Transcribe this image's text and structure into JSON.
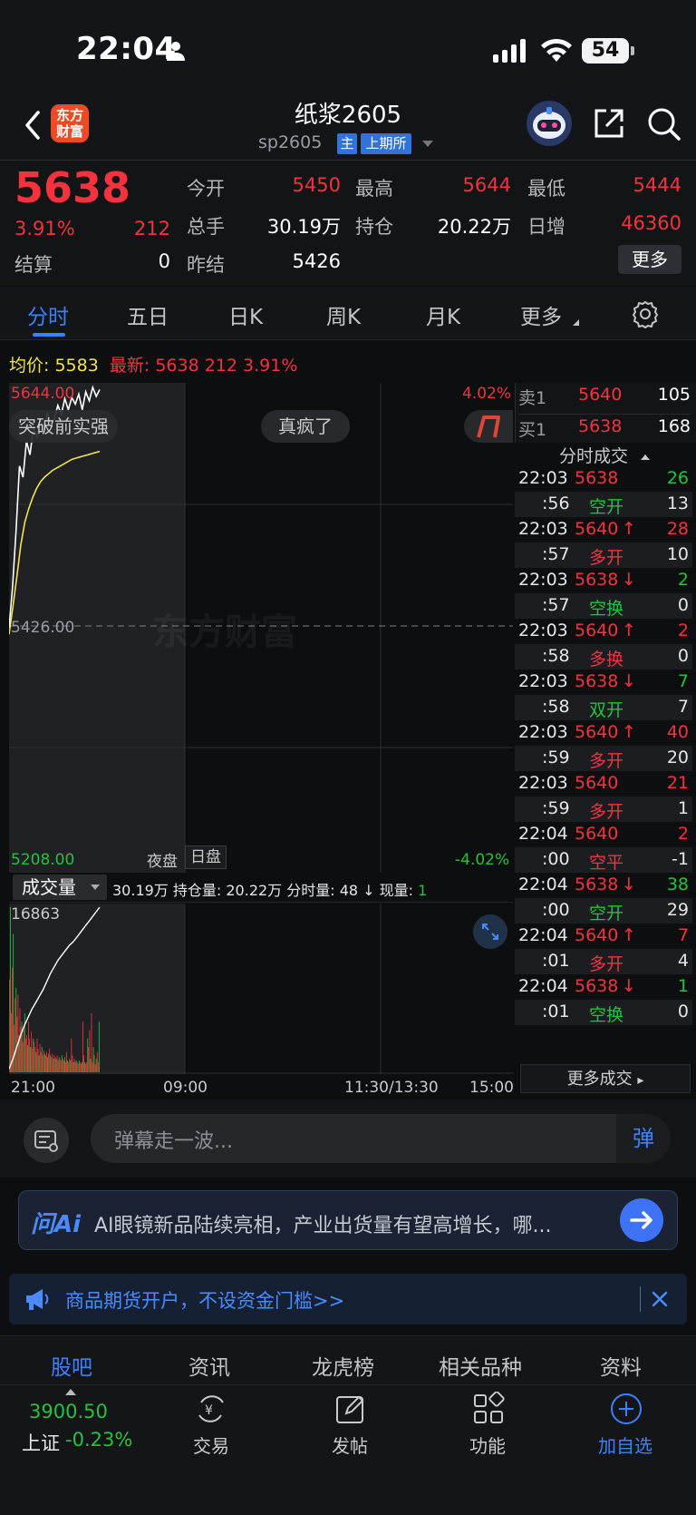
{
  "status_bar": {
    "time": "22:04",
    "battery": "54"
  },
  "header": {
    "app_logo": "东方财富",
    "title": "纸浆2605",
    "code": "sp2605",
    "badge_main": "主",
    "badge_exchange": "上期所"
  },
  "quote": {
    "price": "5638",
    "change_pct": "3.91%",
    "change": "212",
    "settle_label": "结算",
    "settle_value": "0",
    "open_label": "今开",
    "open_value": "5450",
    "volume_label": "总手",
    "volume_value": "30.19万",
    "prev_settle_label": "昨结",
    "prev_settle_value": "5426",
    "high_label": "最高",
    "high_value": "5644",
    "oi_label": "持仓",
    "oi_value": "20.22万",
    "low_label": "最低",
    "low_value": "5444",
    "daily_inc_label": "日增",
    "daily_inc_value": "46360",
    "more_button": "更多"
  },
  "tabs": [
    "分时",
    "五日",
    "日K",
    "周K",
    "月K",
    "更多"
  ],
  "intraday": {
    "avg_label": "均价:",
    "avg_value": "5583",
    "latest_label": "最新:",
    "latest_value": "5638",
    "latest_chg": "212",
    "latest_pct": "3.91%",
    "y_max_label": "5644.00",
    "y_mid_label": "5426.00",
    "y_min_label": "5208.00",
    "pct_max_label": "4.02%",
    "pct_min_label": "-4.02%",
    "session_night": "夜盘",
    "session_day": "日盘",
    "watermark": "东方财富",
    "bubbles": [
      "突破前实强",
      "真疯了"
    ],
    "time_labels": [
      "21:00",
      "09:00",
      "11:30/13:30",
      "15:00"
    ],
    "price_line": [
      5426,
      5462,
      5512,
      5570,
      5560,
      5592,
      5580,
      5604,
      5596,
      5612,
      5600,
      5618,
      5605,
      5612,
      5624,
      5616,
      5630,
      5620,
      5631,
      5625,
      5634,
      5620,
      5636,
      5628,
      5640,
      5632,
      5638
    ],
    "avg_line": [
      5420,
      5445,
      5472,
      5500,
      5520,
      5532,
      5542,
      5550,
      5556,
      5560,
      5563,
      5566,
      5568,
      5570,
      5572,
      5574,
      5576,
      5577,
      5578,
      5579,
      5580,
      5581,
      5582,
      5583
    ]
  },
  "volume": {
    "selector_label": "成交量",
    "info": "30.19万 持仓量: 20.22万 分时量: 48 ↓ 现量:",
    "now_qty": "1",
    "max_label": "16863",
    "bars": [
      0.55,
      0.98,
      0.35,
      0.62,
      0.82,
      0.28,
      0.44,
      0.5,
      0.33,
      0.46,
      0.22,
      0.38,
      0.27,
      0.3,
      0.18,
      0.25,
      0.35,
      0.2,
      0.22,
      0.16,
      0.3,
      0.2,
      0.15,
      0.24,
      0.14,
      0.2,
      0.18,
      0.15,
      0.12,
      0.2,
      0.14,
      0.1,
      0.17,
      0.12,
      0.15,
      0.1,
      0.13,
      0.11,
      0.1,
      0.12,
      0.09,
      0.11,
      0.14,
      0.1,
      0.09,
      0.11,
      0.08,
      0.1,
      0.09,
      0.08,
      0.1,
      0.07,
      0.09,
      0.08,
      0.07,
      0.1,
      0.08,
      0.07,
      0.09,
      0.06,
      0.12,
      0.07,
      0.06,
      0.08,
      0.07,
      0.2,
      0.1,
      0.06,
      0.08,
      0.06,
      0.07,
      0.06,
      0.05,
      0.07,
      0.06,
      0.05,
      0.06,
      0.3,
      0.1,
      0.06,
      0.05,
      0.06,
      0.2,
      0.15,
      0.25,
      0.08,
      0.35,
      0.06,
      0.15,
      0.1,
      0.05,
      0.08,
      0.12,
      0.06,
      0.3
    ],
    "cum_line": [
      0.02,
      0.08,
      0.15,
      0.22,
      0.28,
      0.33,
      0.38,
      0.42,
      0.46,
      0.5,
      0.55,
      0.6,
      0.64,
      0.68,
      0.71,
      0.74,
      0.77,
      0.79,
      0.82,
      0.85,
      0.88,
      0.91,
      0.94,
      0.97,
      1.0
    ]
  },
  "order_book": {
    "sell_label": "卖1",
    "sell_price": "5640",
    "sell_qty": "105",
    "buy_label": "买1",
    "buy_price": "5638",
    "buy_qty": "168",
    "trades_title": "分时成交"
  },
  "trades": [
    {
      "time": "22:03",
      "price": "5638",
      "arrow": "",
      "qty": "26",
      "pcolor": "#f5323d",
      "qcolor": "#22c33b"
    },
    {
      "time": ":56",
      "price": "空开",
      "arrow": "",
      "qty": "13",
      "pcolor": "#22c33b",
      "qcolor": "#e6e6e6",
      "shaded": true
    },
    {
      "time": "22:03",
      "price": "5640",
      "arrow": "↑",
      "qty": "28",
      "pcolor": "#f5323d",
      "qcolor": "#f5323d"
    },
    {
      "time": ":57",
      "price": "多开",
      "arrow": "",
      "qty": "10",
      "pcolor": "#f5323d",
      "qcolor": "#e6e6e6",
      "shaded": true
    },
    {
      "time": "22:03",
      "price": "5638",
      "arrow": "↓",
      "qty": "2",
      "pcolor": "#f5323d",
      "qcolor": "#22c33b"
    },
    {
      "time": ":57",
      "price": "空换",
      "arrow": "",
      "qty": "0",
      "pcolor": "#22c33b",
      "qcolor": "#e6e6e6",
      "shaded": true
    },
    {
      "time": "22:03",
      "price": "5640",
      "arrow": "↑",
      "qty": "2",
      "pcolor": "#f5323d",
      "qcolor": "#f5323d"
    },
    {
      "time": ":58",
      "price": "多换",
      "arrow": "",
      "qty": "0",
      "pcolor": "#f5323d",
      "qcolor": "#e6e6e6",
      "shaded": true
    },
    {
      "time": "22:03",
      "price": "5638",
      "arrow": "↓",
      "qty": "7",
      "pcolor": "#f5323d",
      "qcolor": "#22c33b"
    },
    {
      "time": ":58",
      "price": "双开",
      "arrow": "",
      "qty": "7",
      "pcolor": "#22c33b",
      "qcolor": "#e6e6e6",
      "shaded": true
    },
    {
      "time": "22:03",
      "price": "5640",
      "arrow": "↑",
      "qty": "40",
      "pcolor": "#f5323d",
      "qcolor": "#f5323d"
    },
    {
      "time": ":59",
      "price": "多开",
      "arrow": "",
      "qty": "20",
      "pcolor": "#f5323d",
      "qcolor": "#e6e6e6",
      "shaded": true
    },
    {
      "time": "22:03",
      "price": "5640",
      "arrow": "",
      "qty": "21",
      "pcolor": "#f5323d",
      "qcolor": "#f5323d"
    },
    {
      "time": ":59",
      "price": "多开",
      "arrow": "",
      "qty": "1",
      "pcolor": "#f5323d",
      "qcolor": "#e6e6e6",
      "shaded": true
    },
    {
      "time": "22:04",
      "price": "5640",
      "arrow": "",
      "qty": "2",
      "pcolor": "#f5323d",
      "qcolor": "#f5323d"
    },
    {
      "time": ":00",
      "price": "空平",
      "arrow": "",
      "qty": "-1",
      "pcolor": "#f5323d",
      "qcolor": "#e6e6e6",
      "shaded": true
    },
    {
      "time": "22:04",
      "price": "5638",
      "arrow": "↓",
      "qty": "38",
      "pcolor": "#f5323d",
      "qcolor": "#22c33b"
    },
    {
      "time": ":00",
      "price": "空开",
      "arrow": "",
      "qty": "29",
      "pcolor": "#22c33b",
      "qcolor": "#e6e6e6",
      "shaded": true
    },
    {
      "time": "22:04",
      "price": "5640",
      "arrow": "↑",
      "qty": "7",
      "pcolor": "#f5323d",
      "qcolor": "#f5323d"
    },
    {
      "time": ":01",
      "price": "多开",
      "arrow": "",
      "qty": "4",
      "pcolor": "#f5323d",
      "qcolor": "#e6e6e6",
      "shaded": true
    },
    {
      "time": "22:04",
      "price": "5638",
      "arrow": "↓",
      "qty": "1",
      "pcolor": "#f5323d",
      "qcolor": "#22c33b"
    },
    {
      "time": ":01",
      "price": "空换",
      "arrow": "",
      "qty": "0",
      "pcolor": "#22c33b",
      "qcolor": "#e6e6e6",
      "shaded": true
    }
  ],
  "more_trades": "更多成交",
  "danmu": {
    "placeholder": "弹幕走一波...",
    "send": "弹"
  },
  "ai": {
    "logo": "问Ai",
    "text": "AI眼镜新品陆续亮相，产业出货量有望高增长，哪..."
  },
  "promo": {
    "text": "商品期货开户，不设资金门槛>>"
  },
  "subnav": [
    "股吧",
    "资讯",
    "龙虎榜",
    "相关品种",
    "资料"
  ],
  "tabbar": {
    "index_value": "3900.50",
    "index_name": "上证",
    "index_pct": "-0.23%",
    "items": [
      "交易",
      "发帖",
      "功能",
      "加自选"
    ]
  },
  "colors": {
    "up": "#f5323d",
    "down": "#22c33b",
    "accent": "#3b82ff",
    "avg": "#f3e24a"
  }
}
